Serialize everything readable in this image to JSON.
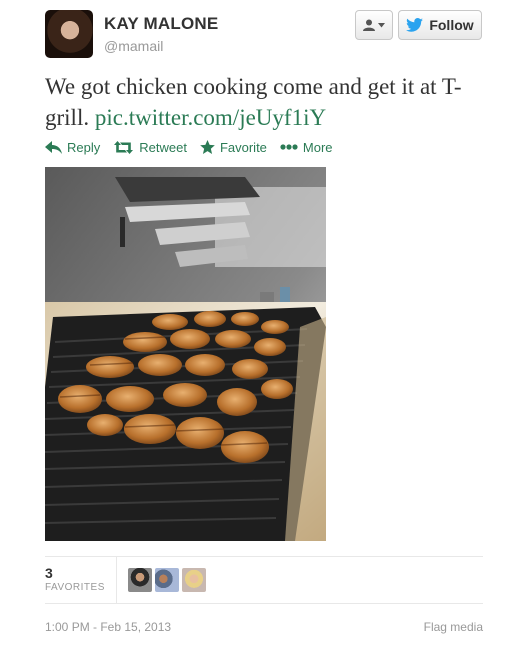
{
  "user": {
    "fullname": "KAY MALONE",
    "username": "@mamail"
  },
  "header_buttons": {
    "follow_label": "Follow"
  },
  "tweet": {
    "text": "We got chicken cooking come and get it at T-grill. ",
    "link": "pic.twitter.com/jeUyf1iY"
  },
  "actions": {
    "reply": "Reply",
    "retweet": "Retweet",
    "favorite": "Favorite",
    "more": "More"
  },
  "stats": {
    "favorites_count": "3",
    "favorites_label": "FAVORITES"
  },
  "footer": {
    "timestamp": "1:00 PM - Feb 15, 2013",
    "flag_media": "Flag media"
  },
  "colors": {
    "link": "#2b7b55",
    "twitter_blue": "#2aa3ef",
    "meta_gray": "#999999"
  },
  "icons": [
    "user-icon",
    "chevron-down-icon",
    "twitter-bird-icon",
    "reply-icon",
    "retweet-icon",
    "star-icon",
    "ellipsis-icon"
  ]
}
